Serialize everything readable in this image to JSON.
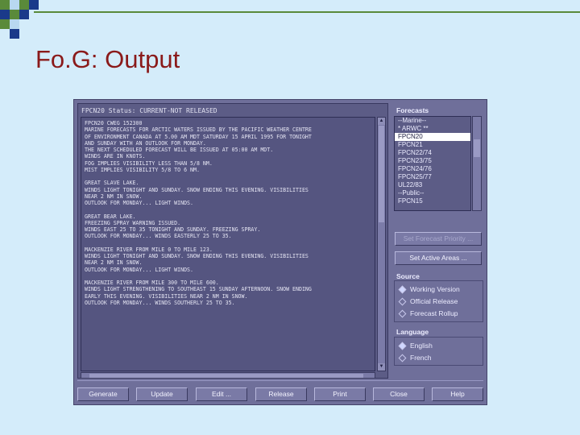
{
  "slide": {
    "title": "Fo.G: Output"
  },
  "window": {
    "status": "FPCN20  Status: CURRENT-NOT RELEASED",
    "forecast_text": [
      "FPCN20 CWEG 152300",
      "MARINE FORECASTS FOR ARCTIC WATERS ISSUED BY THE PACIFIC WEATHER CENTRE",
      "OF ENVIRONMENT CANADA AT 5.00 AM MDT SATURDAY 15 APRIL 1995 FOR TONIGHT",
      "AND SUNDAY WITH AN OUTLOOK FOR MONDAY.",
      "THE NEXT SCHEDULED FORECAST WILL BE ISSUED AT 05:00 AM MDT.",
      "WINDS ARE IN KNOTS.",
      "FOG IMPLIES VISIBILITY LESS THAN 5/8 NM.",
      "MIST IMPLIES VISIBILITY 5/8 TO 6 NM.",
      "",
      "GREAT SLAVE LAKE.",
      "WINDS LIGHT TONIGHT AND SUNDAY. SNOW ENDING THIS EVENING. VISIBILITIES",
      "NEAR 2 NM IN SNOW.",
      "OUTLOOK FOR MONDAY... LIGHT WINDS.",
      "",
      "GREAT BEAR LAKE.",
      "FREEZING SPRAY WARNING ISSUED.",
      "WINDS EAST 25 TO 35 TONIGHT AND SUNDAY. FREEZING SPRAY.",
      "OUTLOOK FOR MONDAY... WINDS EASTERLY 25 TO 35.",
      "",
      "MACKENZIE RIVER FROM MILE 0 TO MILE 123.",
      "WINDS LIGHT TONIGHT AND SUNDAY. SNOW ENDING THIS EVENING. VISIBILITIES",
      "NEAR 2 NM IN SNOW.",
      "OUTLOOK FOR MONDAY... LIGHT WINDS.",
      "",
      "MACKENZIE RIVER FROM MILE 300 TO MILE 600.",
      "WINDS LIGHT STRENGTHENING TO SOUTHEAST 15 SUNDAY AFTERNOON. SNOW ENDING",
      "EARLY THIS EVENING. VISIBILITIES NEAR 2 NM IN SNOW.",
      "OUTLOOK FOR MONDAY... WINDS SOUTHERLY 25 TO 35."
    ],
    "forecasts_label": "Forecasts",
    "forecasts": [
      {
        "label": "--Marine--",
        "selected": false
      },
      {
        "label": "* ARWC **",
        "selected": false
      },
      {
        "label": "FPCN20",
        "selected": true
      },
      {
        "label": "FPCN21",
        "selected": false
      },
      {
        "label": "FPCN22/74",
        "selected": false
      },
      {
        "label": "FPCN23/75",
        "selected": false
      },
      {
        "label": "FPCN24/76",
        "selected": false
      },
      {
        "label": "FPCN25/77",
        "selected": false
      },
      {
        "label": "UL22/83",
        "selected": false
      },
      {
        "label": "--Public--",
        "selected": false
      },
      {
        "label": "FPCN15",
        "selected": false
      }
    ],
    "set_forecast_priority": "Set Forecast Priority ...",
    "set_active_areas": "Set Active Areas ...",
    "source_label": "Source",
    "source_options": [
      {
        "label": "Working Version",
        "checked": true
      },
      {
        "label": "Official Release",
        "checked": false
      },
      {
        "label": "Forecast Rollup",
        "checked": false
      }
    ],
    "language_label": "Language",
    "language_options": [
      {
        "label": "English",
        "checked": true
      },
      {
        "label": "French",
        "checked": false
      }
    ],
    "buttons": {
      "generate": "Generate",
      "update": "Update",
      "edit": "Edit ...",
      "release": "Release",
      "print": "Print",
      "close": "Close",
      "help": "Help"
    }
  },
  "colors": {
    "slide_background": "#d4ecfa",
    "title_color": "#8a1a1a",
    "window_background": "#6f6f9a"
  }
}
